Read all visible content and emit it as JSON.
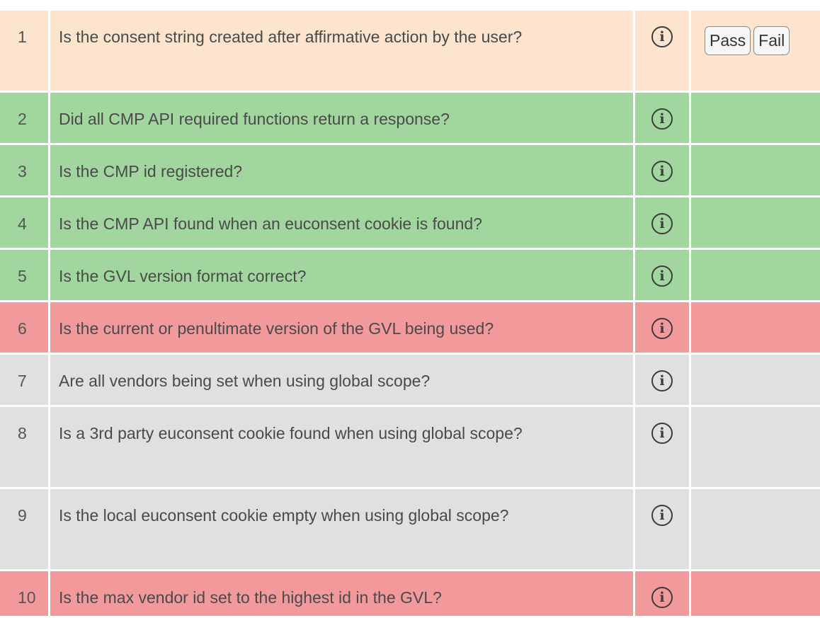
{
  "colors": {
    "pending": "#fde4cf",
    "pass": "#a1d69e",
    "fail": "#f2999c",
    "not_applicable": "#e0e0e0"
  },
  "info_icon": "info-circle-icon",
  "info_glyph": "i",
  "buttons": {
    "pass_label": "Pass",
    "fail_label": "Fail"
  },
  "rows": [
    {
      "num": "1",
      "question": "Is the consent string created after affirmative action by the user?",
      "status": "pending"
    },
    {
      "num": "2",
      "question": "Did all CMP API required functions return a response?",
      "status": "pass"
    },
    {
      "num": "3",
      "question": "Is the CMP id registered?",
      "status": "pass"
    },
    {
      "num": "4",
      "question": "Is the CMP API found when an euconsent cookie is found?",
      "status": "pass"
    },
    {
      "num": "5",
      "question": "Is the GVL version format correct?",
      "status": "pass"
    },
    {
      "num": "6",
      "question": "Is the current or penultimate version of the GVL being used?",
      "status": "fail"
    },
    {
      "num": "7",
      "question": "Are all vendors being set when using global scope?",
      "status": "not_applicable"
    },
    {
      "num": "8",
      "question": "Is a 3rd party euconsent cookie found when using global scope?",
      "status": "not_applicable"
    },
    {
      "num": "9",
      "question": "Is the local euconsent cookie empty when using global scope?",
      "status": "not_applicable"
    },
    {
      "num": "10",
      "question": "Is the max vendor id set to the highest id in the GVL?",
      "status": "fail"
    }
  ]
}
